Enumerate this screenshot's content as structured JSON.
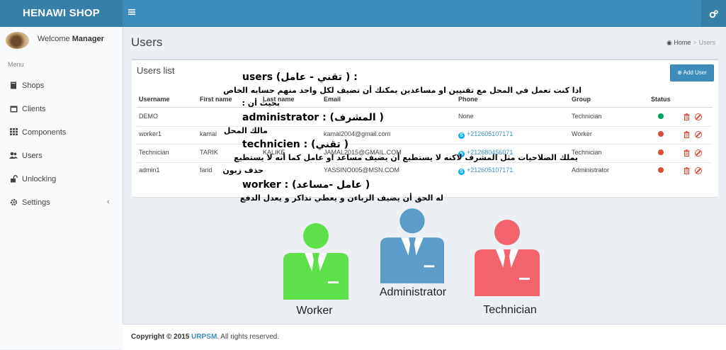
{
  "header": {
    "logo": "HENAWI SHOP",
    "toggle_icon": "bars-icon",
    "settings_icon": "cogs-icon"
  },
  "sidebar": {
    "welcome_prefix": "Welcome",
    "welcome_user": "Manager",
    "menu_heading": "Menu",
    "items": [
      {
        "label": "Shops",
        "icon": "book-icon"
      },
      {
        "label": "Clients",
        "icon": "calendar-icon"
      },
      {
        "label": "Components",
        "icon": "grid-icon"
      },
      {
        "label": "Users",
        "icon": "users-icon"
      },
      {
        "label": "Unlocking",
        "icon": "unlock-icon"
      },
      {
        "label": "Settings",
        "icon": "gear-icon"
      }
    ]
  },
  "page": {
    "title": "Users",
    "breadcrumb": {
      "home": "Home",
      "current": "Users"
    }
  },
  "users_box": {
    "title": "Users list",
    "add_button": "Add User",
    "columns": [
      "Username",
      "First name",
      "Last name",
      "Email",
      "Phone",
      "Group",
      "Status"
    ],
    "rows": [
      {
        "username": "DEMO",
        "first_name": "",
        "last_name": "",
        "email": "",
        "phone": "None",
        "group": "Technician",
        "status_color": "#00a65a"
      },
      {
        "username": "worker1",
        "first_name": "kamal",
        "last_name": "",
        "email": "kamal2004@gmail.com",
        "phone": "+212605107171",
        "group": "Worker",
        "status_color": "#dd4b39"
      },
      {
        "username": "Technician",
        "first_name": "TARIK",
        "last_name": "KALIKE",
        "email": "JAMAL2015@GMAIL.COM",
        "phone": "+212680456071",
        "group": "Technician",
        "status_color": "#dd4b39"
      },
      {
        "username": "admin1",
        "first_name": "farid",
        "last_name": "",
        "email": "YASSINO005@MSN.COM",
        "phone": "+212605107171",
        "group": "Administrator",
        "status_color": "#dd4b39"
      }
    ]
  },
  "overlay": {
    "users_heading": "users (تقني - عامل ) :",
    "users_desc": "اذا كنت تعمل في المحل مع تقنيين او مساعدين يمكنك أن تضيف لكل واحد منهم حسابه الخاص",
    "users_desc2": "بحيث أن :",
    "admin_heading": "administrator : (المشرف )",
    "admin_desc": "مالك المحل",
    "tech_heading": "technicien  : (تقني )",
    "tech_desc": "يملك الصلاحيات مثل المشرف لاكنه لا يستطيع أن يضيف مساعد او عامل    كما أنه لا يستطيع",
    "tech_desc2": "حذف زبون",
    "worker_heading": "worker : (عامل -مساعد )",
    "worker_desc": "له الحق أن يضيف الزباءن و يعطي تذاكر و يعدل الدفع"
  },
  "roles": [
    {
      "label": "Worker",
      "color": "#5ee04a"
    },
    {
      "label": "Administrator",
      "color": "#5b9cc8"
    },
    {
      "label": "Technician",
      "color": "#f2636b"
    }
  ],
  "footer": {
    "copyright": "Copyright © 2015",
    "brand": "URPSM",
    "rights": ". All rights reserved."
  }
}
